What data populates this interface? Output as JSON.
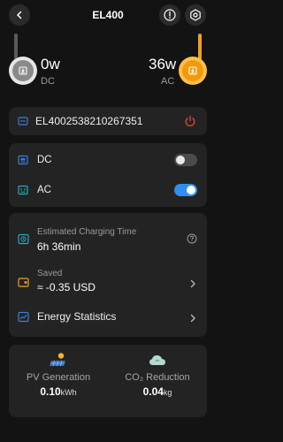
{
  "header": {
    "title": "EL400"
  },
  "ports": {
    "dc": {
      "value": "0w",
      "label": "DC"
    },
    "ac": {
      "value": "36w",
      "label": "AC"
    }
  },
  "device": {
    "serial": "EL4002538210267351"
  },
  "outputs": {
    "dc": {
      "label": "DC",
      "enabled": false
    },
    "ac": {
      "label": "AC",
      "enabled": true
    }
  },
  "info": {
    "charging_time": {
      "label": "Estimated Charging Time",
      "value": "6h 36min"
    },
    "saved": {
      "label": "Saved",
      "value": "≈ -0.35 USD"
    },
    "energy_stats": {
      "label": "Energy Statistics"
    }
  },
  "stats": {
    "pv": {
      "label": "PV Generation",
      "value": "0.10",
      "unit": "kWh"
    },
    "co2": {
      "label": "CO₂ Reduction",
      "value": "0.04",
      "unit": "kg"
    }
  },
  "colors": {
    "accent_orange": "#f19a0b",
    "toggle_on": "#2f8ff0",
    "power_red": "#e0403a",
    "icon_blue": "#3b7fd8",
    "icon_teal": "#2aa8b8",
    "icon_orange": "#f0a11a",
    "card_bg": "#232323",
    "page_bg": "#131313"
  }
}
